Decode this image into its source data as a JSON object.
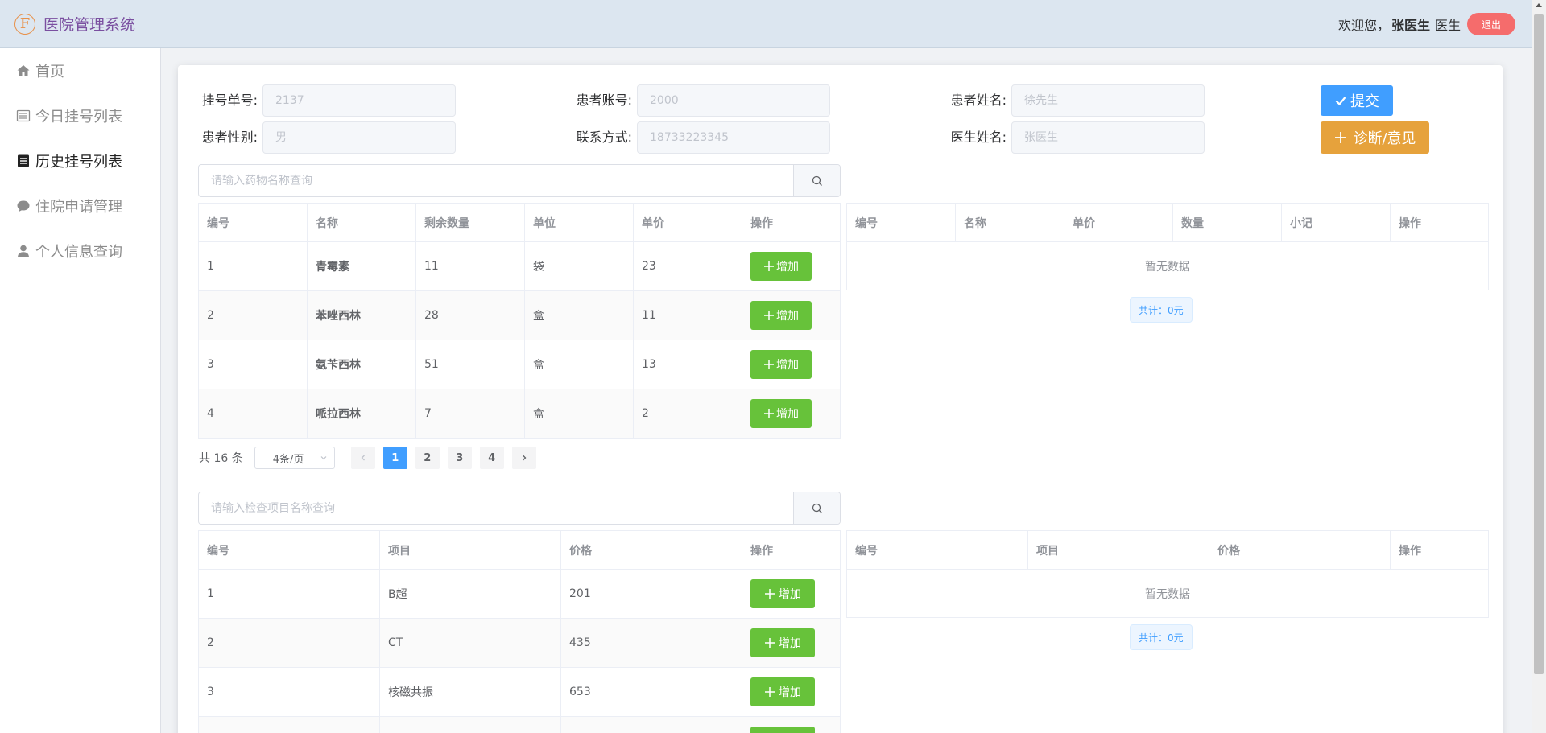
{
  "app": {
    "logo_letter": "F",
    "title": "医院管理系统"
  },
  "user": {
    "welcome": "欢迎您，",
    "name": "张医生",
    "role": "医生",
    "logout_label": "退出"
  },
  "sidebar": {
    "items": [
      {
        "label": "首页",
        "icon": "home-icon",
        "active": false
      },
      {
        "label": "今日挂号列表",
        "icon": "list-icon",
        "active": false
      },
      {
        "label": "历史挂号列表",
        "icon": "document-icon",
        "active": true
      },
      {
        "label": "住院申请管理",
        "icon": "chat-icon",
        "active": false
      },
      {
        "label": "个人信息查询",
        "icon": "user-icon",
        "active": false
      }
    ]
  },
  "form": {
    "register_no": {
      "label": "挂号单号:",
      "value": "2137"
    },
    "patient_account": {
      "label": "患者账号:",
      "value": "2000"
    },
    "patient_name": {
      "label": "患者姓名:",
      "value": "徐先生"
    },
    "patient_gender": {
      "label": "患者性别:",
      "value": "男"
    },
    "contact": {
      "label": "联系方式:",
      "value": "18733223345"
    },
    "doctor_name": {
      "label": "医生姓名:",
      "value": "张医生"
    }
  },
  "actions": {
    "submit_label": "提交",
    "diagnosis_label": "诊断/意见"
  },
  "drug_search": {
    "placeholder": "请输入药物名称查询"
  },
  "drug_table": {
    "headers": [
      "编号",
      "名称",
      "剩余数量",
      "单位",
      "单价",
      "操作"
    ],
    "rows": [
      {
        "id": "1",
        "name": "青霉素",
        "qty": "11",
        "unit": "袋",
        "price": "23"
      },
      {
        "id": "2",
        "name": "苯唑西林",
        "qty": "28",
        "unit": "盒",
        "price": "11"
      },
      {
        "id": "3",
        "name": "氨苄西林",
        "qty": "51",
        "unit": "盒",
        "price": "13"
      },
      {
        "id": "4",
        "name": "哌拉西林",
        "qty": "7",
        "unit": "盒",
        "price": "2"
      }
    ],
    "add_label": "增加"
  },
  "drug_cart": {
    "headers": [
      "编号",
      "名称",
      "单价",
      "数量",
      "小记",
      "操作"
    ],
    "empty_text": "暂无数据",
    "total": "共计：0元"
  },
  "pagination": {
    "total_text": "共 16 条",
    "page_size": "4条/页",
    "pages": [
      "1",
      "2",
      "3",
      "4"
    ],
    "current": "1"
  },
  "exam_search": {
    "placeholder": "请输入检查项目名称查询"
  },
  "exam_table": {
    "headers": [
      "编号",
      "项目",
      "价格",
      "操作"
    ],
    "rows": [
      {
        "id": "1",
        "name": "B超",
        "price": "201"
      },
      {
        "id": "2",
        "name": "CT",
        "price": "435"
      },
      {
        "id": "3",
        "name": "核磁共振",
        "price": "653"
      }
    ],
    "add_label": "增加"
  },
  "exam_cart": {
    "headers": [
      "编号",
      "项目",
      "价格",
      "操作"
    ],
    "empty_text": "暂无数据",
    "total": "共计：0元"
  },
  "colors": {
    "primary": "#409eff",
    "success": "#67c23a",
    "warning": "#e6a23c",
    "danger": "#f56c6c",
    "header_bg": "#dce6f0",
    "logo": "#7a4fa0"
  }
}
